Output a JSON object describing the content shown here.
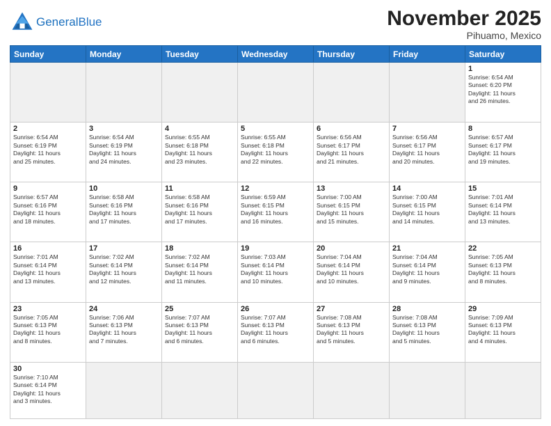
{
  "header": {
    "logo_general": "General",
    "logo_blue": "Blue",
    "month_title": "November 2025",
    "location": "Pihuamo, Mexico"
  },
  "weekdays": [
    "Sunday",
    "Monday",
    "Tuesday",
    "Wednesday",
    "Thursday",
    "Friday",
    "Saturday"
  ],
  "weeks": [
    [
      {
        "day": null,
        "info": ""
      },
      {
        "day": null,
        "info": ""
      },
      {
        "day": null,
        "info": ""
      },
      {
        "day": null,
        "info": ""
      },
      {
        "day": null,
        "info": ""
      },
      {
        "day": null,
        "info": ""
      },
      {
        "day": "1",
        "info": "Sunrise: 6:54 AM\nSunset: 6:20 PM\nDaylight: 11 hours\nand 26 minutes."
      }
    ],
    [
      {
        "day": "2",
        "info": "Sunrise: 6:54 AM\nSunset: 6:19 PM\nDaylight: 11 hours\nand 25 minutes."
      },
      {
        "day": "3",
        "info": "Sunrise: 6:54 AM\nSunset: 6:19 PM\nDaylight: 11 hours\nand 24 minutes."
      },
      {
        "day": "4",
        "info": "Sunrise: 6:55 AM\nSunset: 6:18 PM\nDaylight: 11 hours\nand 23 minutes."
      },
      {
        "day": "5",
        "info": "Sunrise: 6:55 AM\nSunset: 6:18 PM\nDaylight: 11 hours\nand 22 minutes."
      },
      {
        "day": "6",
        "info": "Sunrise: 6:56 AM\nSunset: 6:17 PM\nDaylight: 11 hours\nand 21 minutes."
      },
      {
        "day": "7",
        "info": "Sunrise: 6:56 AM\nSunset: 6:17 PM\nDaylight: 11 hours\nand 20 minutes."
      },
      {
        "day": "8",
        "info": "Sunrise: 6:57 AM\nSunset: 6:17 PM\nDaylight: 11 hours\nand 19 minutes."
      }
    ],
    [
      {
        "day": "9",
        "info": "Sunrise: 6:57 AM\nSunset: 6:16 PM\nDaylight: 11 hours\nand 18 minutes."
      },
      {
        "day": "10",
        "info": "Sunrise: 6:58 AM\nSunset: 6:16 PM\nDaylight: 11 hours\nand 17 minutes."
      },
      {
        "day": "11",
        "info": "Sunrise: 6:58 AM\nSunset: 6:16 PM\nDaylight: 11 hours\nand 17 minutes."
      },
      {
        "day": "12",
        "info": "Sunrise: 6:59 AM\nSunset: 6:15 PM\nDaylight: 11 hours\nand 16 minutes."
      },
      {
        "day": "13",
        "info": "Sunrise: 7:00 AM\nSunset: 6:15 PM\nDaylight: 11 hours\nand 15 minutes."
      },
      {
        "day": "14",
        "info": "Sunrise: 7:00 AM\nSunset: 6:15 PM\nDaylight: 11 hours\nand 14 minutes."
      },
      {
        "day": "15",
        "info": "Sunrise: 7:01 AM\nSunset: 6:14 PM\nDaylight: 11 hours\nand 13 minutes."
      }
    ],
    [
      {
        "day": "16",
        "info": "Sunrise: 7:01 AM\nSunset: 6:14 PM\nDaylight: 11 hours\nand 13 minutes."
      },
      {
        "day": "17",
        "info": "Sunrise: 7:02 AM\nSunset: 6:14 PM\nDaylight: 11 hours\nand 12 minutes."
      },
      {
        "day": "18",
        "info": "Sunrise: 7:02 AM\nSunset: 6:14 PM\nDaylight: 11 hours\nand 11 minutes."
      },
      {
        "day": "19",
        "info": "Sunrise: 7:03 AM\nSunset: 6:14 PM\nDaylight: 11 hours\nand 10 minutes."
      },
      {
        "day": "20",
        "info": "Sunrise: 7:04 AM\nSunset: 6:14 PM\nDaylight: 11 hours\nand 10 minutes."
      },
      {
        "day": "21",
        "info": "Sunrise: 7:04 AM\nSunset: 6:14 PM\nDaylight: 11 hours\nand 9 minutes."
      },
      {
        "day": "22",
        "info": "Sunrise: 7:05 AM\nSunset: 6:13 PM\nDaylight: 11 hours\nand 8 minutes."
      }
    ],
    [
      {
        "day": "23",
        "info": "Sunrise: 7:05 AM\nSunset: 6:13 PM\nDaylight: 11 hours\nand 8 minutes."
      },
      {
        "day": "24",
        "info": "Sunrise: 7:06 AM\nSunset: 6:13 PM\nDaylight: 11 hours\nand 7 minutes."
      },
      {
        "day": "25",
        "info": "Sunrise: 7:07 AM\nSunset: 6:13 PM\nDaylight: 11 hours\nand 6 minutes."
      },
      {
        "day": "26",
        "info": "Sunrise: 7:07 AM\nSunset: 6:13 PM\nDaylight: 11 hours\nand 6 minutes."
      },
      {
        "day": "27",
        "info": "Sunrise: 7:08 AM\nSunset: 6:13 PM\nDaylight: 11 hours\nand 5 minutes."
      },
      {
        "day": "28",
        "info": "Sunrise: 7:08 AM\nSunset: 6:13 PM\nDaylight: 11 hours\nand 5 minutes."
      },
      {
        "day": "29",
        "info": "Sunrise: 7:09 AM\nSunset: 6:13 PM\nDaylight: 11 hours\nand 4 minutes."
      }
    ],
    [
      {
        "day": "30",
        "info": "Sunrise: 7:10 AM\nSunset: 6:14 PM\nDaylight: 11 hours\nand 3 minutes."
      },
      {
        "day": null,
        "info": ""
      },
      {
        "day": null,
        "info": ""
      },
      {
        "day": null,
        "info": ""
      },
      {
        "day": null,
        "info": ""
      },
      {
        "day": null,
        "info": ""
      },
      {
        "day": null,
        "info": ""
      }
    ]
  ]
}
